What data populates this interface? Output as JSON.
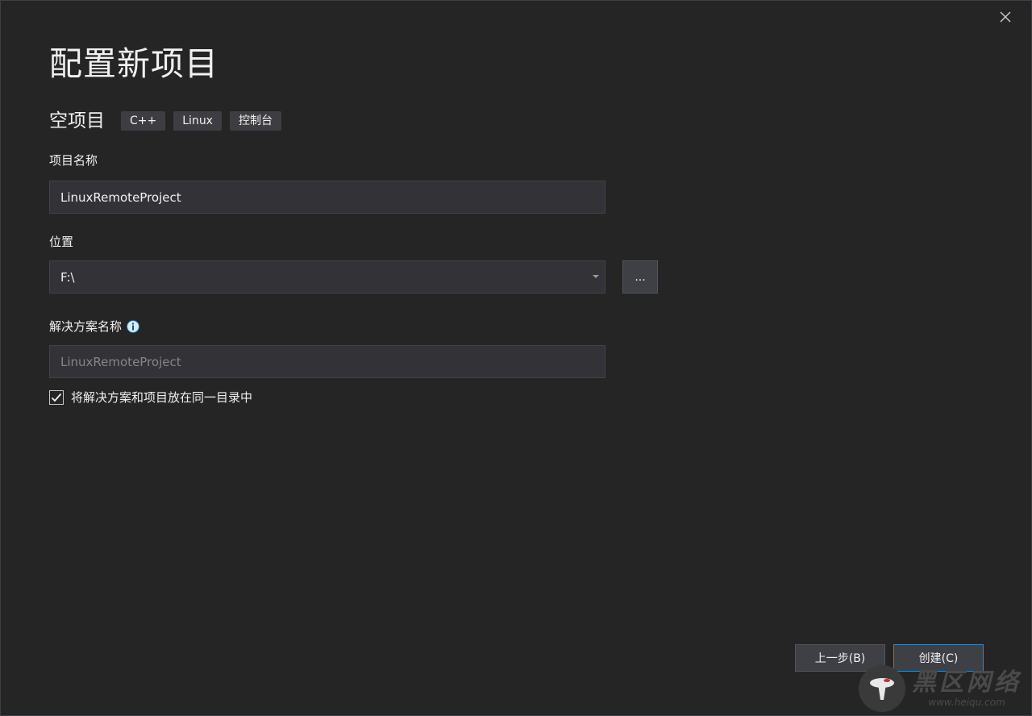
{
  "dialog": {
    "title": "配置新项目",
    "template_name": "空项目",
    "tags": [
      "C++",
      "Linux",
      "控制台"
    ]
  },
  "project_name": {
    "label": "项目名称",
    "value": "LinuxRemoteProject"
  },
  "location": {
    "label": "位置",
    "value": "F:\\",
    "browse_label": "..."
  },
  "solution_name": {
    "label": "解决方案名称",
    "placeholder": "LinuxRemoteProject"
  },
  "same_directory": {
    "label": "将解决方案和项目放在同一目录中",
    "checked": true
  },
  "buttons": {
    "back_label": "上一步(B)",
    "create_label": "创建(C)"
  },
  "watermark": {
    "title": "黑区网络",
    "url": "www.heiqu.com"
  },
  "colors": {
    "background": "#252526",
    "input_bg": "#333337",
    "accent": "#0097fb",
    "info_icon": "#d7eaf7"
  }
}
